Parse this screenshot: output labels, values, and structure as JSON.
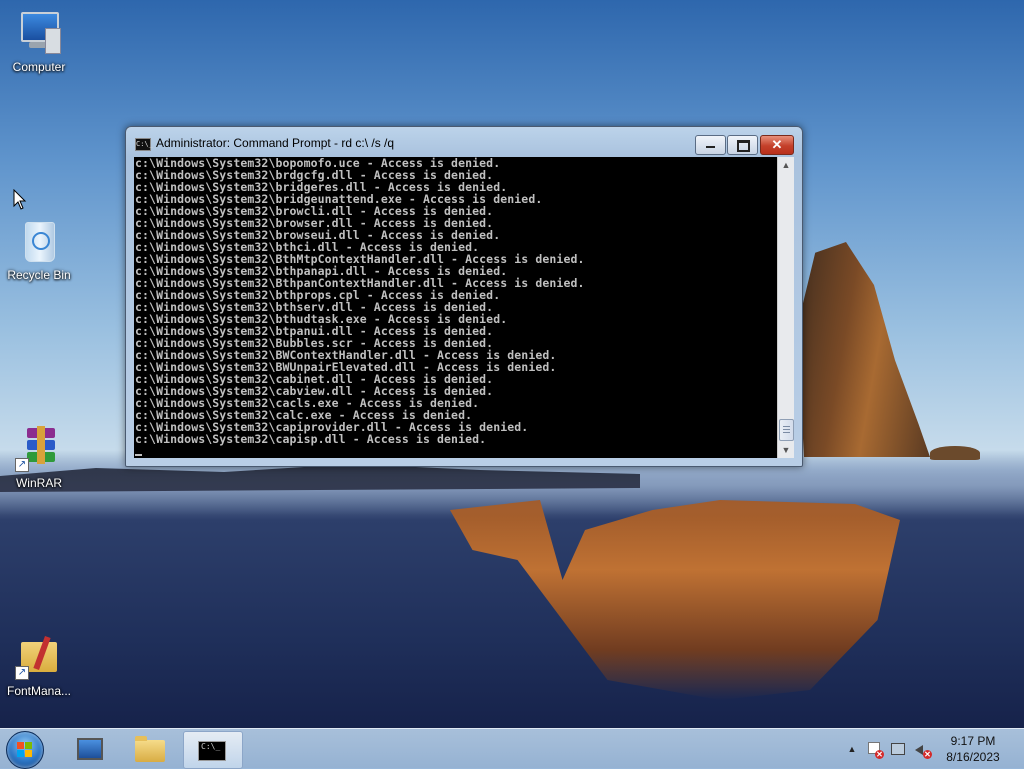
{
  "desktop": {
    "icons": [
      {
        "label": "Computer"
      },
      {
        "label": "Recycle Bin"
      },
      {
        "label": "WinRAR"
      },
      {
        "label": "FontMana..."
      }
    ]
  },
  "cmd_window": {
    "title": "Administrator:  Command Prompt - rd  c:\\ /s /q",
    "lines": [
      "c:\\Windows\\System32\\bopomofo.uce - Access is denied.",
      "c:\\Windows\\System32\\brdgcfg.dll - Access is denied.",
      "c:\\Windows\\System32\\bridgeres.dll - Access is denied.",
      "c:\\Windows\\System32\\bridgeunattend.exe - Access is denied.",
      "c:\\Windows\\System32\\browcli.dll - Access is denied.",
      "c:\\Windows\\System32\\browser.dll - Access is denied.",
      "c:\\Windows\\System32\\browseui.dll - Access is denied.",
      "c:\\Windows\\System32\\bthci.dll - Access is denied.",
      "c:\\Windows\\System32\\BthMtpContextHandler.dll - Access is denied.",
      "c:\\Windows\\System32\\bthpanapi.dll - Access is denied.",
      "c:\\Windows\\System32\\BthpanContextHandler.dll - Access is denied.",
      "c:\\Windows\\System32\\bthprops.cpl - Access is denied.",
      "c:\\Windows\\System32\\bthserv.dll - Access is denied.",
      "c:\\Windows\\System32\\bthudtask.exe - Access is denied.",
      "c:\\Windows\\System32\\btpanui.dll - Access is denied.",
      "c:\\Windows\\System32\\Bubbles.scr - Access is denied.",
      "c:\\Windows\\System32\\BWContextHandler.dll - Access is denied.",
      "c:\\Windows\\System32\\BWUnpairElevated.dll - Access is denied.",
      "c:\\Windows\\System32\\cabinet.dll - Access is denied.",
      "c:\\Windows\\System32\\cabview.dll - Access is denied.",
      "c:\\Windows\\System32\\cacls.exe - Access is denied.",
      "c:\\Windows\\System32\\calc.exe - Access is denied.",
      "c:\\Windows\\System32\\capiprovider.dll - Access is denied.",
      "c:\\Windows\\System32\\capisp.dll - Access is denied."
    ],
    "buttons": {
      "minimize": "minimize-icon",
      "maximize": "maximize-icon",
      "close": "close-icon"
    },
    "icon_text": "C:\\_"
  },
  "taskbar": {
    "buttons": [
      {
        "name": "server-manager"
      },
      {
        "name": "windows-explorer"
      },
      {
        "name": "command-prompt",
        "text": "C:\\_",
        "active": true
      }
    ],
    "clock": {
      "time": "9:17 PM",
      "date": "8/16/2023"
    },
    "tray_up_arrow": "▲",
    "close_glyph": "✕"
  },
  "colors": {
    "console_bg": "#000000",
    "console_fg": "#c0c0c0",
    "accent": "#2d76c4"
  }
}
